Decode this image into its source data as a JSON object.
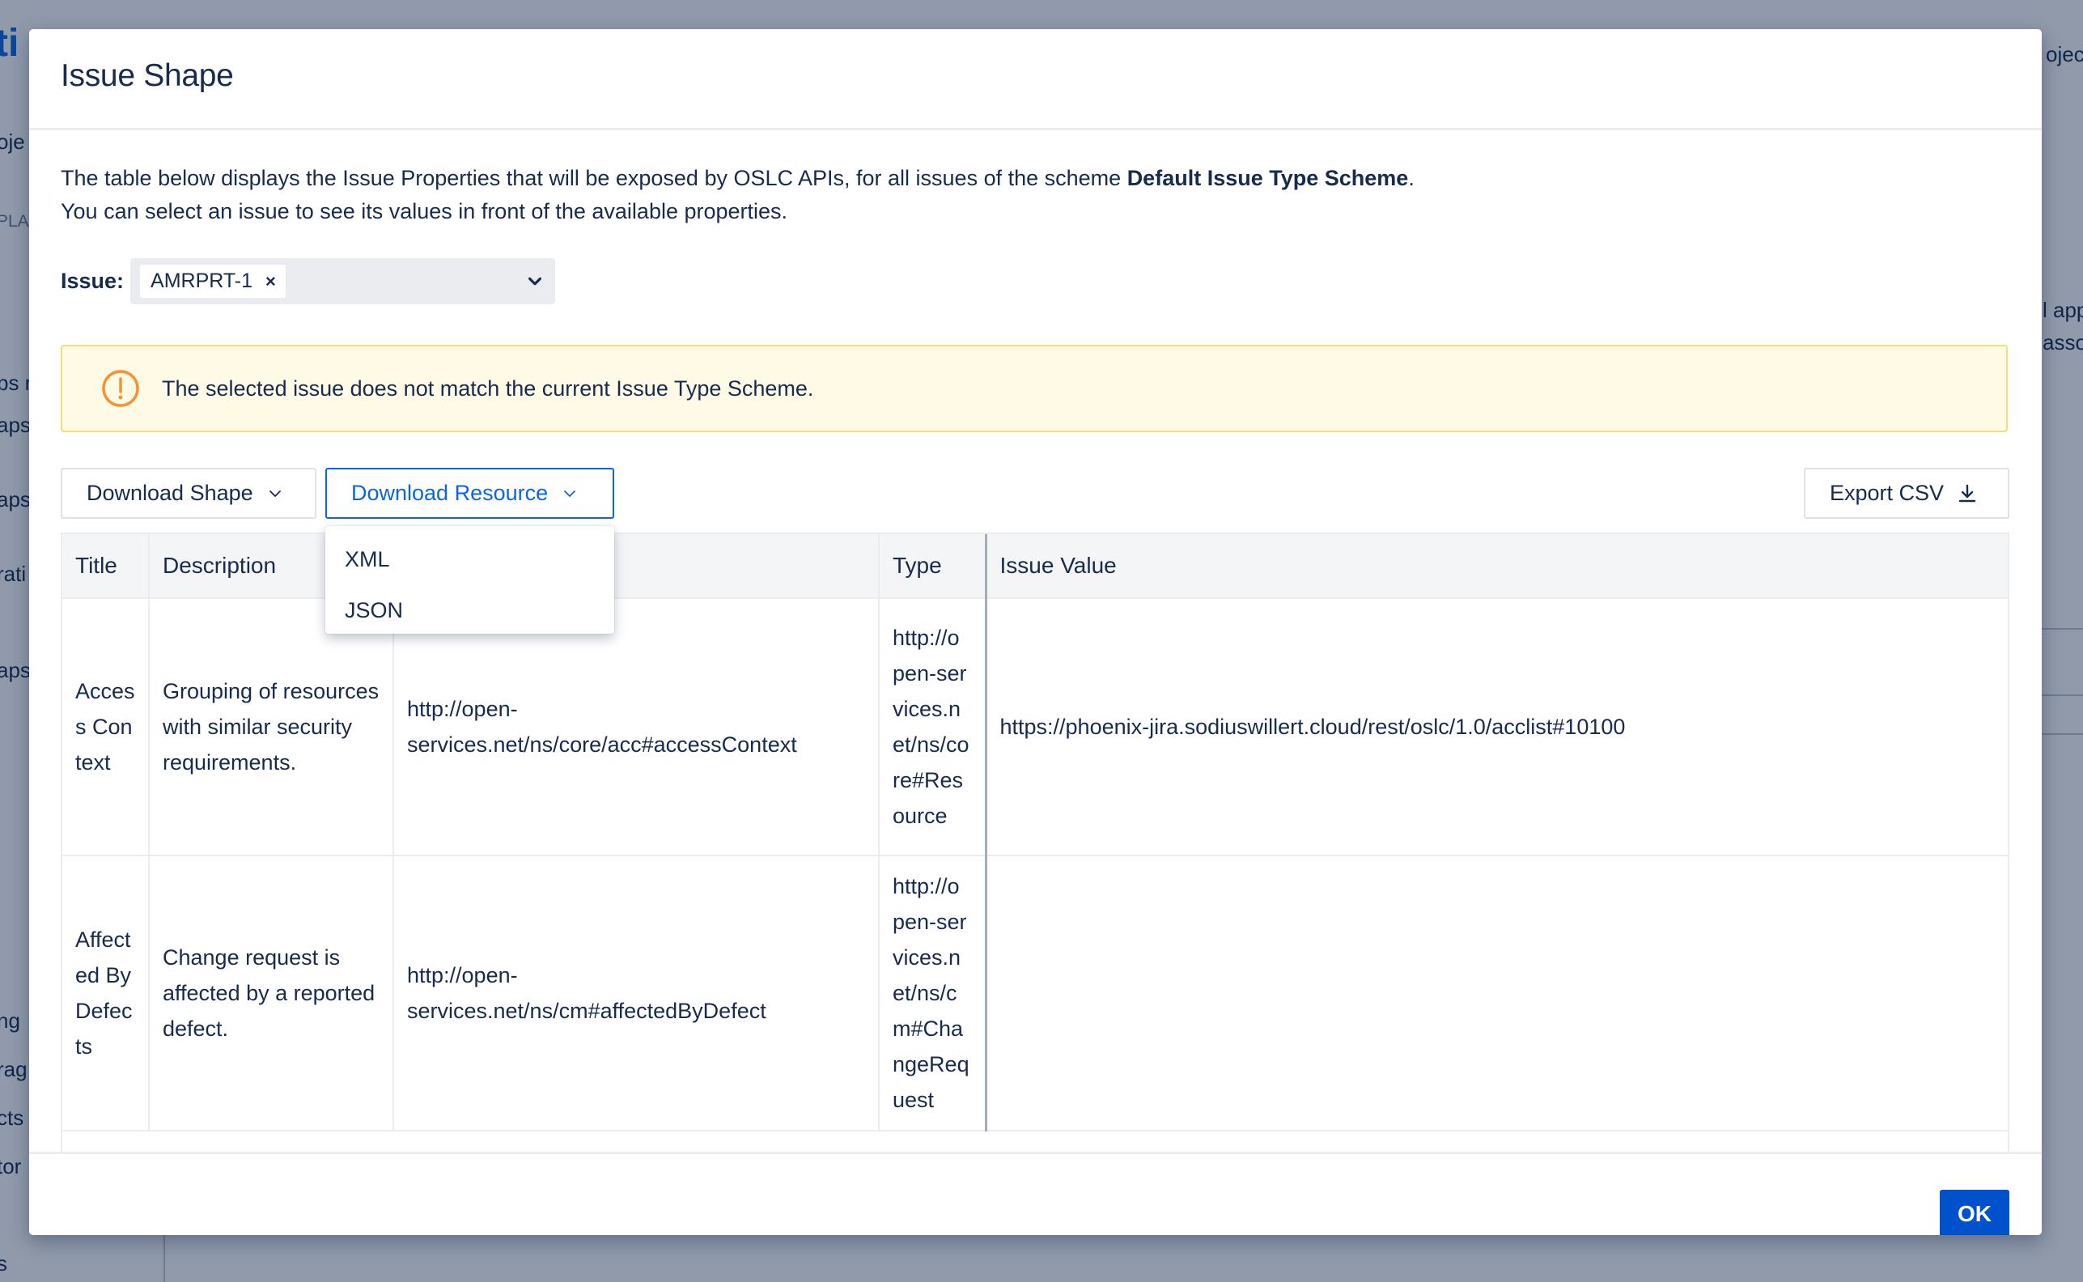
{
  "background": {
    "fragments": [
      "ti",
      "ojec",
      "oje",
      "PLA",
      "ps r",
      "aps",
      "aps",
      "rati",
      "aps",
      "ng",
      "rag",
      "cts",
      "tor",
      "s",
      "l app",
      "asso"
    ]
  },
  "modal": {
    "title": "Issue Shape",
    "intro_line1_before": "The table below displays the Issue Properties that will be exposed by OSLC APIs, for all issues of the scheme ",
    "intro_scheme": "Default Issue Type Scheme",
    "intro_line1_after": ".",
    "intro_line2": "You can select an issue to see its values in front of the available properties.",
    "issue_label": "Issue:",
    "issue_chip": "AMRPRT-1",
    "chip_remove": "×",
    "warning_text": "The selected issue does not match the current Issue Type Scheme.",
    "buttons": {
      "download_shape": "Download Shape",
      "download_resource": "Download Resource",
      "export_csv": "Export CSV"
    },
    "menu": [
      "XML",
      "JSON"
    ],
    "table": {
      "headers": [
        "Title",
        "Description",
        "",
        "Type",
        "Issue Value"
      ],
      "rows": [
        {
          "title": "Access Context",
          "description": "Grouping of resources with similar security requirements.",
          "property": "http://open-services.net/ns/core/acc#accessContext",
          "type": "http://open-services.net/ns/core#Resource",
          "value": "https://phoenix-jira.sodiuswillert.cloud/rest/oslc/1.0/acclist#10100"
        },
        {
          "title": "Affected By Defects",
          "description": "Change request is affected by a reported defect.",
          "property": "http://open-services.net/ns/cm#affectedByDefect",
          "type": "http://open-services.net/ns/cm#ChangeRequest",
          "value": ""
        }
      ]
    },
    "ok_label": "OK"
  },
  "colors": {
    "primary": "#0052cc",
    "link": "#0c66e4",
    "warning_bg": "#fffae6",
    "warning_border": "#f6dc76",
    "warning_icon": "#f79232",
    "text": "#172b4d"
  }
}
